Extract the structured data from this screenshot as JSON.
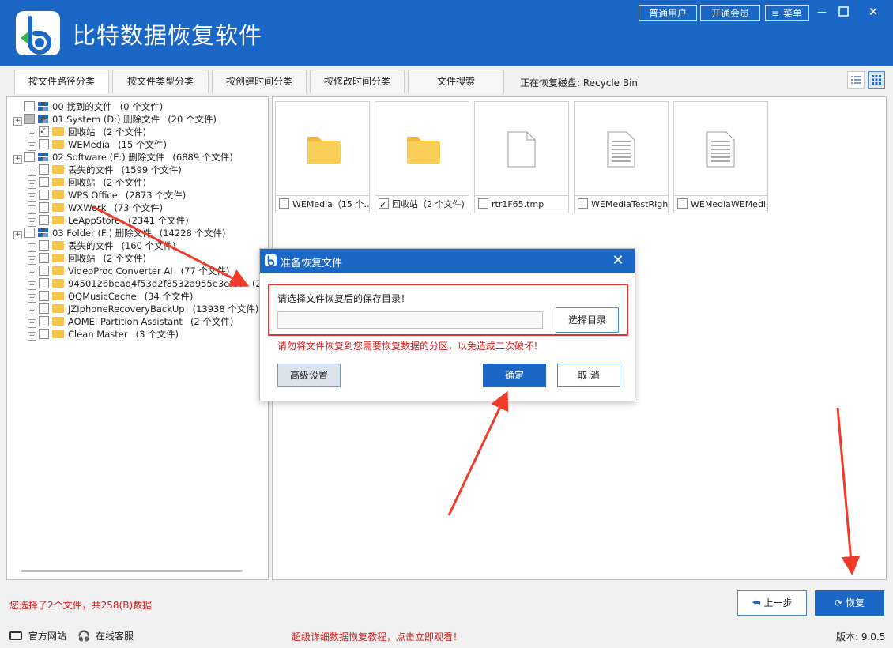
{
  "app": {
    "title": "比特数据恢复软件",
    "header_buttons": [
      "普通用户",
      "开通会员",
      "菜单"
    ],
    "window_controls": [
      "—",
      "□",
      "✕"
    ]
  },
  "tabs": [
    {
      "label": "按文件路径分类",
      "active": true
    },
    {
      "label": "按文件类型分类",
      "active": false
    },
    {
      "label": "按创建时间分类",
      "active": false
    },
    {
      "label": "按修改时间分类",
      "active": false
    },
    {
      "label": "文件搜索",
      "active": false
    }
  ],
  "recovering_label": "正在恢复磁盘: Recycle Bin",
  "tree": [
    {
      "label": "00 找到的文件",
      "count": "(0 个文件)",
      "level": 0,
      "kind": "disk",
      "check": "none",
      "expander": false
    },
    {
      "label": "01 System (D:) 删除文件",
      "count": "(20 个文件)",
      "level": 0,
      "kind": "disk",
      "check": "partial",
      "expander": true
    },
    {
      "label": "回收站",
      "count": "(2 个文件)",
      "level": 1,
      "kind": "folder",
      "check": "checked",
      "expander": true
    },
    {
      "label": "WEMedia",
      "count": "(15 个文件)",
      "level": 1,
      "kind": "folder",
      "check": "none",
      "expander": true
    },
    {
      "label": "02 Software (E:) 删除文件",
      "count": "(6889 个文件)",
      "level": 0,
      "kind": "disk",
      "check": "none",
      "expander": true
    },
    {
      "label": "丢失的文件",
      "count": "(1599 个文件)",
      "level": 1,
      "kind": "folder",
      "check": "none",
      "expander": true
    },
    {
      "label": "回收站",
      "count": "(2 个文件)",
      "level": 1,
      "kind": "folder",
      "check": "none",
      "expander": true
    },
    {
      "label": "WPS Office",
      "count": "(2873 个文件)",
      "level": 1,
      "kind": "folder",
      "check": "none",
      "expander": true
    },
    {
      "label": "WXWork",
      "count": "(73 个文件)",
      "level": 1,
      "kind": "folder",
      "check": "none",
      "expander": true
    },
    {
      "label": "LeAppStore",
      "count": "(2341 个文件)",
      "level": 1,
      "kind": "folder",
      "check": "none",
      "expander": true
    },
    {
      "label": "03 Folder (F:) 删除文件",
      "count": "(14228 个文件)",
      "level": 0,
      "kind": "disk",
      "check": "none",
      "expander": true
    },
    {
      "label": "丢失的文件",
      "count": "(160 个文件)",
      "level": 1,
      "kind": "folder",
      "check": "none",
      "expander": true
    },
    {
      "label": "回收站",
      "count": "(2 个文件)",
      "level": 1,
      "kind": "folder",
      "check": "none",
      "expander": true
    },
    {
      "label": "VideoProc Converter AI",
      "count": "(77 个文件)",
      "level": 1,
      "kind": "folder",
      "check": "none",
      "expander": true
    },
    {
      "label": "9450126bead4f53d2f8532a955e3ef67",
      "count": "(2 个文",
      "level": 1,
      "kind": "folder",
      "check": "none",
      "expander": true
    },
    {
      "label": "QQMusicCache",
      "count": "(34 个文件)",
      "level": 1,
      "kind": "folder",
      "check": "none",
      "expander": true
    },
    {
      "label": "JZIphoneRecoveryBackUp",
      "count": "(13938 个文件)",
      "level": 1,
      "kind": "folder",
      "check": "none",
      "expander": true
    },
    {
      "label": "AOMEI Partition Assistant",
      "count": "(2 个文件)",
      "level": 1,
      "kind": "folder",
      "check": "none",
      "expander": true
    },
    {
      "label": "Clean Master",
      "count": "(3 个文件)",
      "level": 1,
      "kind": "folder",
      "check": "none",
      "expander": true
    }
  ],
  "files": [
    {
      "name": "WEMedia（15 个…",
      "icon": "folder-icon",
      "checked": false
    },
    {
      "name": "回收站（2 个文件)",
      "icon": "folder-icon",
      "checked": true
    },
    {
      "name": "rtr1F65.tmp",
      "icon": "file-icon",
      "checked": false
    },
    {
      "name": "WEMediaTestRigh…",
      "icon": "document-icon",
      "checked": false
    },
    {
      "name": "WEMediaWEMedi…",
      "icon": "document-icon",
      "checked": false
    }
  ],
  "dialog": {
    "title": "准备恢复文件",
    "prompt": "请选择文件恢复后的保存目录！",
    "path_value": "",
    "choose_dir_label": "选择目录",
    "warning": "请勿将文件恢复到您需要恢复数据的分区，以免造成二次破坏！",
    "advanced_label": "高级设置",
    "ok_label": "确定",
    "cancel_label": "取 消"
  },
  "footer": {
    "selection_info": "您选择了2个文件，共258(B)数据",
    "prev_label": "上一步",
    "recover_label": "恢复",
    "website_label": "官方网站",
    "support_label": "在线客服",
    "tutorial_label": "超级详细数据恢复教程，点击立即观看！",
    "version_label": "版本: 9.0.5"
  },
  "colors": {
    "brand_blue": "#1a67c5",
    "warning_red": "#d42020",
    "annotation_red": "#f03a2a",
    "folder_yellow": "#f7c548"
  }
}
